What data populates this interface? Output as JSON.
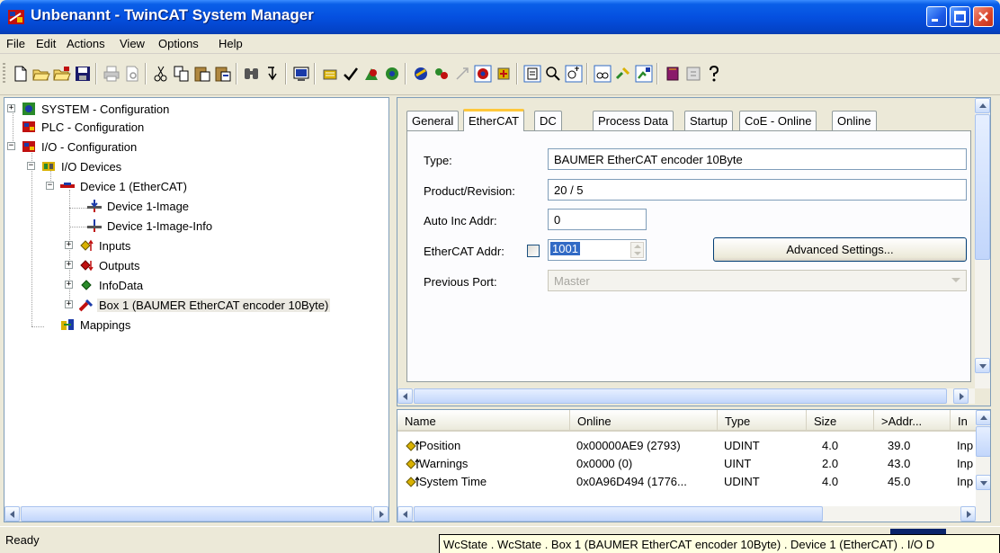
{
  "window": {
    "title": "Unbenannt - TwinCAT System Manager",
    "icon": "twincat-app-icon",
    "buttons": [
      "minimize",
      "maximize",
      "close"
    ]
  },
  "menu": [
    "File",
    "Edit",
    "Actions",
    "View",
    "Options",
    "Help"
  ],
  "toolbar": {
    "icons": [
      "new-icon",
      "open-icon",
      "open-from-target-icon",
      "save-icon",
      "print-icon",
      "print-preview-icon",
      "cut-icon",
      "copy-icon",
      "paste-icon",
      "paste-with-links-icon",
      "find-icon",
      "find-next-icon",
      "generate-mappings-icon",
      "check-configuration-icon",
      "activate-configuration-icon",
      "restart-run-mode-icon",
      "restart-config-mode-icon",
      "reload-devices-icon",
      "scan-devices-icon",
      "toggle-free-run-icon",
      "show-online-data-icon",
      "show-sub-items-icon",
      "zoom-icon",
      "auto-arrange-icon",
      "variable-icon",
      "link-icon",
      "help-book-icon",
      "info-icon",
      "question-icon"
    ]
  },
  "tree": {
    "items": [
      {
        "label": "SYSTEM - Configuration",
        "icon": "system-icon"
      },
      {
        "label": "PLC - Configuration",
        "icon": "plc-icon"
      },
      {
        "label": "I/O - Configuration",
        "icon": "io-config-icon"
      },
      {
        "label": "I/O Devices",
        "icon": "io-devices-icon"
      },
      {
        "label": "Device 1 (EtherCAT)",
        "icon": "ethercat-device-icon"
      },
      {
        "label": "Device 1-Image",
        "icon": "image-icon"
      },
      {
        "label": "Device 1-Image-Info",
        "icon": "image-info-icon"
      },
      {
        "label": "Inputs",
        "icon": "inputs-icon"
      },
      {
        "label": "Outputs",
        "icon": "outputs-icon"
      },
      {
        "label": "InfoData",
        "icon": "infodata-icon"
      },
      {
        "label": "Box 1 (BAUMER EtherCAT encoder 10Byte)",
        "icon": "box-icon"
      },
      {
        "label": "Mappings",
        "icon": "mappings-icon"
      }
    ]
  },
  "tabs": [
    "General",
    "EtherCAT",
    "DC",
    "Process Data",
    "Startup",
    "CoE - Online",
    "Online"
  ],
  "active_tab": "EtherCAT",
  "form": {
    "type_label": "Type:",
    "type_value": "BAUMER EtherCAT encoder 10Byte",
    "product_label": "Product/Revision:",
    "product_value": "20 / 5",
    "autoinc_label": "Auto Inc Addr:",
    "autoinc_value": "0",
    "ecat_label": "EtherCAT Addr:",
    "ecat_value": "1001",
    "advanced_label": "Advanced Settings...",
    "prevport_label": "Previous Port:",
    "prevport_value": "Master"
  },
  "list": {
    "columns": [
      "Name",
      "Online",
      "Type",
      "Size",
      ">Addr...",
      "In"
    ],
    "rows": [
      {
        "name": "Position",
        "online": "0x00000AE9 (2793)",
        "type": "UDINT",
        "size": "4.0",
        "addr": "39.0",
        "in": "Inp"
      },
      {
        "name": "Warnings",
        "online": "0x0000 (0)",
        "type": "UINT",
        "size": "2.0",
        "addr": "43.0",
        "in": "Inp"
      },
      {
        "name": "System Time",
        "online": "0x0A96D494 (1776...",
        "type": "UDINT",
        "size": "4.0",
        "addr": "45.0",
        "in": "Inp"
      }
    ]
  },
  "status": {
    "text": "Ready",
    "tooltip": "WcState . WcState . Box 1 (BAUMER EtherCAT encoder 10Byte) . Device 1 (EtherCAT) . I/O D"
  },
  "colors": {
    "titlebar": "#0550e0",
    "tab_highlight": "#ffc83c",
    "tooltip_bg": "#ffffe1"
  }
}
